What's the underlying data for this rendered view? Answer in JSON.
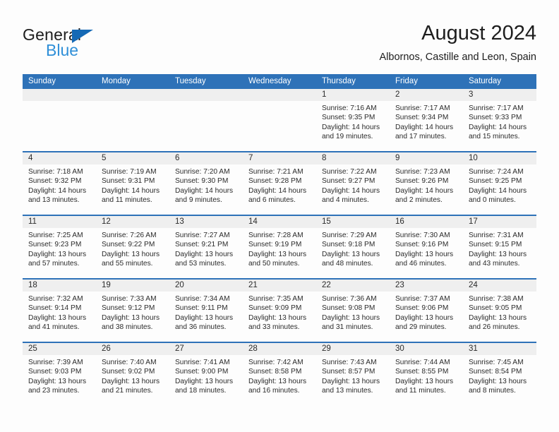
{
  "brand": {
    "name_top": "General",
    "name_bottom": "Blue",
    "triangle_color": "#1569b5",
    "blue_text_color": "#2f8fd8"
  },
  "header": {
    "title": "August 2024",
    "subtitle": "Albornos, Castille and Leon, Spain"
  },
  "theme": {
    "header_blue": "#2e72b8",
    "day_band_gray": "#efefef",
    "page_background": "#fdfdfd",
    "text_color": "#2b2b2b"
  },
  "weekdays": [
    "Sunday",
    "Monday",
    "Tuesday",
    "Wednesday",
    "Thursday",
    "Friday",
    "Saturday"
  ],
  "weeks": [
    [
      {
        "day": "",
        "sunrise": "",
        "sunset": "",
        "daylight_line1": "",
        "daylight_line2": ""
      },
      {
        "day": "",
        "sunrise": "",
        "sunset": "",
        "daylight_line1": "",
        "daylight_line2": ""
      },
      {
        "day": "",
        "sunrise": "",
        "sunset": "",
        "daylight_line1": "",
        "daylight_line2": ""
      },
      {
        "day": "",
        "sunrise": "",
        "sunset": "",
        "daylight_line1": "",
        "daylight_line2": ""
      },
      {
        "day": "1",
        "sunrise": "Sunrise: 7:16 AM",
        "sunset": "Sunset: 9:35 PM",
        "daylight_line1": "Daylight: 14 hours",
        "daylight_line2": "and 19 minutes."
      },
      {
        "day": "2",
        "sunrise": "Sunrise: 7:17 AM",
        "sunset": "Sunset: 9:34 PM",
        "daylight_line1": "Daylight: 14 hours",
        "daylight_line2": "and 17 minutes."
      },
      {
        "day": "3",
        "sunrise": "Sunrise: 7:17 AM",
        "sunset": "Sunset: 9:33 PM",
        "daylight_line1": "Daylight: 14 hours",
        "daylight_line2": "and 15 minutes."
      }
    ],
    [
      {
        "day": "4",
        "sunrise": "Sunrise: 7:18 AM",
        "sunset": "Sunset: 9:32 PM",
        "daylight_line1": "Daylight: 14 hours",
        "daylight_line2": "and 13 minutes."
      },
      {
        "day": "5",
        "sunrise": "Sunrise: 7:19 AM",
        "sunset": "Sunset: 9:31 PM",
        "daylight_line1": "Daylight: 14 hours",
        "daylight_line2": "and 11 minutes."
      },
      {
        "day": "6",
        "sunrise": "Sunrise: 7:20 AM",
        "sunset": "Sunset: 9:30 PM",
        "daylight_line1": "Daylight: 14 hours",
        "daylight_line2": "and 9 minutes."
      },
      {
        "day": "7",
        "sunrise": "Sunrise: 7:21 AM",
        "sunset": "Sunset: 9:28 PM",
        "daylight_line1": "Daylight: 14 hours",
        "daylight_line2": "and 6 minutes."
      },
      {
        "day": "8",
        "sunrise": "Sunrise: 7:22 AM",
        "sunset": "Sunset: 9:27 PM",
        "daylight_line1": "Daylight: 14 hours",
        "daylight_line2": "and 4 minutes."
      },
      {
        "day": "9",
        "sunrise": "Sunrise: 7:23 AM",
        "sunset": "Sunset: 9:26 PM",
        "daylight_line1": "Daylight: 14 hours",
        "daylight_line2": "and 2 minutes."
      },
      {
        "day": "10",
        "sunrise": "Sunrise: 7:24 AM",
        "sunset": "Sunset: 9:25 PM",
        "daylight_line1": "Daylight: 14 hours",
        "daylight_line2": "and 0 minutes."
      }
    ],
    [
      {
        "day": "11",
        "sunrise": "Sunrise: 7:25 AM",
        "sunset": "Sunset: 9:23 PM",
        "daylight_line1": "Daylight: 13 hours",
        "daylight_line2": "and 57 minutes."
      },
      {
        "day": "12",
        "sunrise": "Sunrise: 7:26 AM",
        "sunset": "Sunset: 9:22 PM",
        "daylight_line1": "Daylight: 13 hours",
        "daylight_line2": "and 55 minutes."
      },
      {
        "day": "13",
        "sunrise": "Sunrise: 7:27 AM",
        "sunset": "Sunset: 9:21 PM",
        "daylight_line1": "Daylight: 13 hours",
        "daylight_line2": "and 53 minutes."
      },
      {
        "day": "14",
        "sunrise": "Sunrise: 7:28 AM",
        "sunset": "Sunset: 9:19 PM",
        "daylight_line1": "Daylight: 13 hours",
        "daylight_line2": "and 50 minutes."
      },
      {
        "day": "15",
        "sunrise": "Sunrise: 7:29 AM",
        "sunset": "Sunset: 9:18 PM",
        "daylight_line1": "Daylight: 13 hours",
        "daylight_line2": "and 48 minutes."
      },
      {
        "day": "16",
        "sunrise": "Sunrise: 7:30 AM",
        "sunset": "Sunset: 9:16 PM",
        "daylight_line1": "Daylight: 13 hours",
        "daylight_line2": "and 46 minutes."
      },
      {
        "day": "17",
        "sunrise": "Sunrise: 7:31 AM",
        "sunset": "Sunset: 9:15 PM",
        "daylight_line1": "Daylight: 13 hours",
        "daylight_line2": "and 43 minutes."
      }
    ],
    [
      {
        "day": "18",
        "sunrise": "Sunrise: 7:32 AM",
        "sunset": "Sunset: 9:14 PM",
        "daylight_line1": "Daylight: 13 hours",
        "daylight_line2": "and 41 minutes."
      },
      {
        "day": "19",
        "sunrise": "Sunrise: 7:33 AM",
        "sunset": "Sunset: 9:12 PM",
        "daylight_line1": "Daylight: 13 hours",
        "daylight_line2": "and 38 minutes."
      },
      {
        "day": "20",
        "sunrise": "Sunrise: 7:34 AM",
        "sunset": "Sunset: 9:11 PM",
        "daylight_line1": "Daylight: 13 hours",
        "daylight_line2": "and 36 minutes."
      },
      {
        "day": "21",
        "sunrise": "Sunrise: 7:35 AM",
        "sunset": "Sunset: 9:09 PM",
        "daylight_line1": "Daylight: 13 hours",
        "daylight_line2": "and 33 minutes."
      },
      {
        "day": "22",
        "sunrise": "Sunrise: 7:36 AM",
        "sunset": "Sunset: 9:08 PM",
        "daylight_line1": "Daylight: 13 hours",
        "daylight_line2": "and 31 minutes."
      },
      {
        "day": "23",
        "sunrise": "Sunrise: 7:37 AM",
        "sunset": "Sunset: 9:06 PM",
        "daylight_line1": "Daylight: 13 hours",
        "daylight_line2": "and 29 minutes."
      },
      {
        "day": "24",
        "sunrise": "Sunrise: 7:38 AM",
        "sunset": "Sunset: 9:05 PM",
        "daylight_line1": "Daylight: 13 hours",
        "daylight_line2": "and 26 minutes."
      }
    ],
    [
      {
        "day": "25",
        "sunrise": "Sunrise: 7:39 AM",
        "sunset": "Sunset: 9:03 PM",
        "daylight_line1": "Daylight: 13 hours",
        "daylight_line2": "and 23 minutes."
      },
      {
        "day": "26",
        "sunrise": "Sunrise: 7:40 AM",
        "sunset": "Sunset: 9:02 PM",
        "daylight_line1": "Daylight: 13 hours",
        "daylight_line2": "and 21 minutes."
      },
      {
        "day": "27",
        "sunrise": "Sunrise: 7:41 AM",
        "sunset": "Sunset: 9:00 PM",
        "daylight_line1": "Daylight: 13 hours",
        "daylight_line2": "and 18 minutes."
      },
      {
        "day": "28",
        "sunrise": "Sunrise: 7:42 AM",
        "sunset": "Sunset: 8:58 PM",
        "daylight_line1": "Daylight: 13 hours",
        "daylight_line2": "and 16 minutes."
      },
      {
        "day": "29",
        "sunrise": "Sunrise: 7:43 AM",
        "sunset": "Sunset: 8:57 PM",
        "daylight_line1": "Daylight: 13 hours",
        "daylight_line2": "and 13 minutes."
      },
      {
        "day": "30",
        "sunrise": "Sunrise: 7:44 AM",
        "sunset": "Sunset: 8:55 PM",
        "daylight_line1": "Daylight: 13 hours",
        "daylight_line2": "and 11 minutes."
      },
      {
        "day": "31",
        "sunrise": "Sunrise: 7:45 AM",
        "sunset": "Sunset: 8:54 PM",
        "daylight_line1": "Daylight: 13 hours",
        "daylight_line2": "and 8 minutes."
      }
    ]
  ]
}
